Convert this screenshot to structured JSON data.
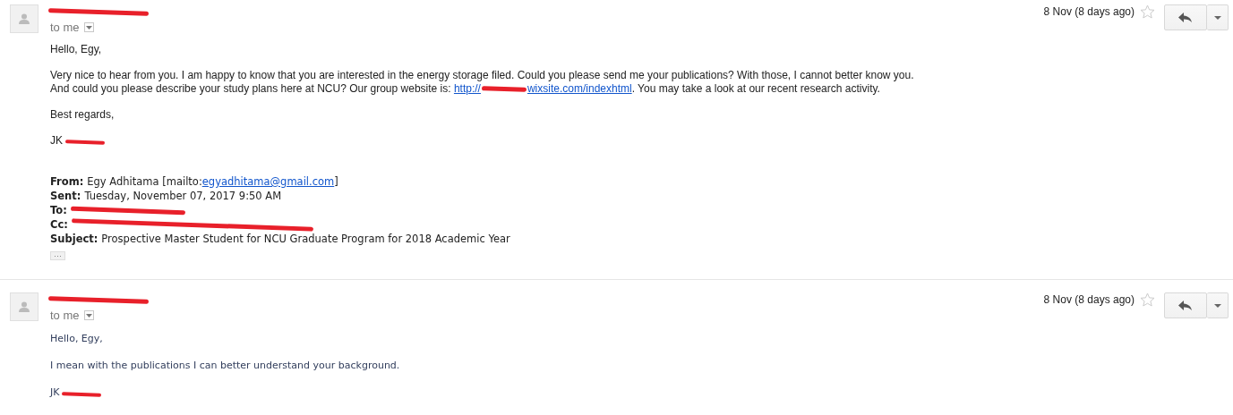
{
  "messages": [
    {
      "recipient": "to me",
      "date": "8 Nov (8 days ago)",
      "starred": false,
      "body": [
        {
          "kind": "text",
          "text": "Hello, Egy,"
        },
        {
          "kind": "link_paragraph",
          "lines": [
            "Very nice to hear from you. I am happy to know that you are interested in the energy storage filed. Could you please send me your publications? With those, I cannot better know you."
          ],
          "before": "And could you please describe your study plans here at NCU? Our group website is: ",
          "link_start": "http://",
          "link_end": "wixsite.com/indexhtml",
          "after": ". You may take a look at our recent research activity."
        },
        {
          "kind": "text",
          "text": "Best regards,"
        },
        {
          "kind": "signature",
          "text": "JK"
        }
      ],
      "quoted_header": [
        {
          "kind": "field",
          "label": "From:",
          "text": "Egy Adhitama [mailto:",
          "link": "egyadhitama@gmail.com",
          "after": "]"
        },
        {
          "kind": "field",
          "label": "Sent:",
          "text": "Tuesday, November 07, 2017 9:50 AM"
        },
        {
          "kind": "redacted",
          "label": "To:"
        },
        {
          "kind": "redacted",
          "label": "Cc:"
        },
        {
          "kind": "field",
          "label": "Subject:",
          "text": "Prospective Master Student for NCU Graduate Program for 2018 Academic Year"
        }
      ],
      "show_trimmed": "···"
    },
    {
      "recipient": "to me",
      "date": "8 Nov (8 days ago)",
      "starred": false,
      "body": [
        {
          "kind": "text",
          "text": "Hello, Egy,"
        },
        {
          "kind": "text",
          "text": "I mean with the publications I can better understand your background."
        },
        {
          "kind": "signature",
          "text": "JK"
        }
      ]
    }
  ]
}
